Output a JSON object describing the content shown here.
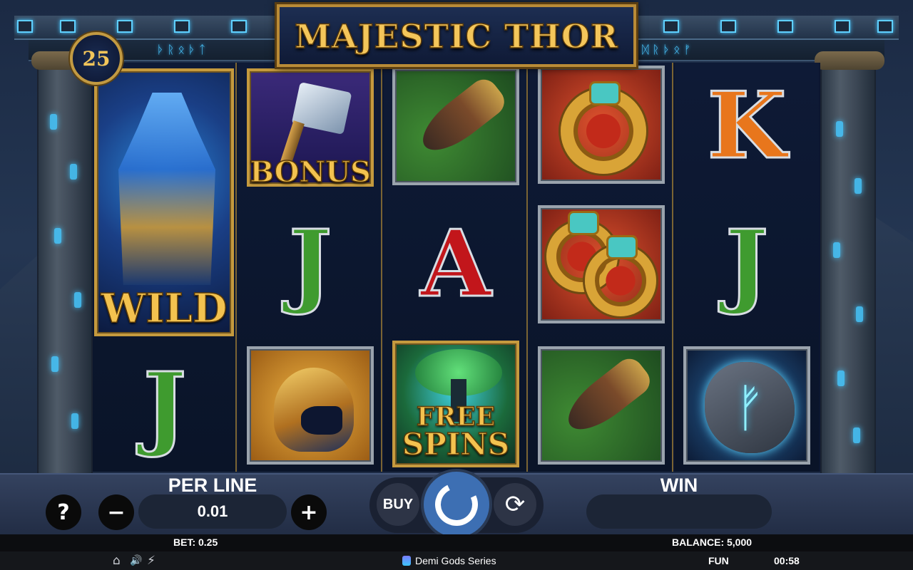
{
  "game": {
    "title": "MAJESTIC THOR",
    "lines": "25"
  },
  "reels": {
    "symbols": {
      "wild": "WILD",
      "bonus": "BONUS",
      "free_spins_line1": "FREE",
      "free_spins_line2": "SPINS",
      "j": "J",
      "a": "A",
      "k": "K",
      "rune_glyph": "ᚠ"
    }
  },
  "controls": {
    "per_line_label": "PER LINE",
    "per_line_value": "0.01",
    "minus": "−",
    "plus": "+",
    "help": "?",
    "buy": "BUY",
    "autoplay_glyph": "⟳",
    "win_label": "WIN",
    "win_value": ""
  },
  "footer": {
    "bet": "BET: 0.25",
    "balance": "BALANCE: 5,000",
    "series": "Demi Gods Series",
    "mode": "FUN",
    "time": "00:58",
    "home_icon": "⌂",
    "sound_icon": "🔊",
    "turbo_icon": "⚡"
  }
}
